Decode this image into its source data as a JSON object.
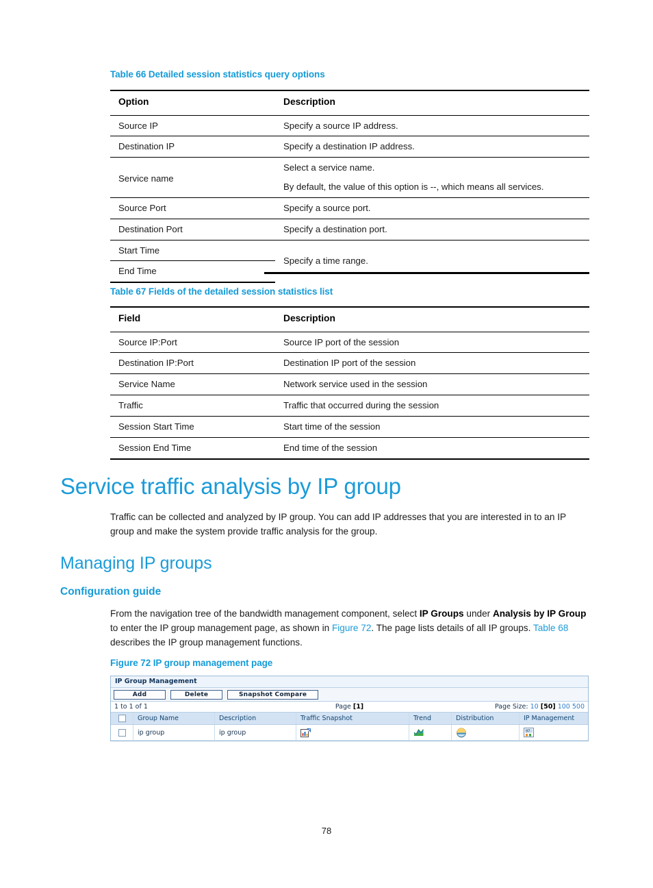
{
  "colors": {
    "heading_blue": "#1b9bd8",
    "caption_blue": "#159bd7",
    "link_blue": "#2b7fd1",
    "ui_header_blue": "#d3e3f4"
  },
  "table66": {
    "caption": "Table 66 Detailed session statistics query options",
    "headers": [
      "Option",
      "Description"
    ],
    "rows": [
      {
        "option": "Source IP",
        "description": [
          "Specify a source IP address."
        ]
      },
      {
        "option": "Destination IP",
        "description": [
          "Specify a destination IP address."
        ]
      },
      {
        "option": "Service name",
        "description": [
          "Select a service name.",
          "By default, the value of this option is --, which means all services."
        ]
      },
      {
        "option": "Source Port",
        "description": [
          "Specify a source port."
        ]
      },
      {
        "option": "Destination Port",
        "description": [
          "Specify a destination port."
        ]
      },
      {
        "option": "Start Time",
        "description": [
          "Specify a time range."
        ]
      },
      {
        "option": "End Time",
        "description": [
          ""
        ]
      }
    ]
  },
  "table67": {
    "caption": "Table 67 Fields of the detailed session statistics list",
    "headers": [
      "Field",
      "Description"
    ],
    "rows": [
      {
        "field": "Source IP:Port",
        "description": "Source IP port of the session"
      },
      {
        "field": "Destination IP:Port",
        "description": "Destination IP port of the session"
      },
      {
        "field": "Service Name",
        "description": "Network service used in the session"
      },
      {
        "field": "Traffic",
        "description": "Traffic that occurred during the session"
      },
      {
        "field": "Session Start Time",
        "description": "Start time of the session"
      },
      {
        "field": "Session End Time",
        "description": "End time of the session"
      }
    ]
  },
  "section": {
    "h1": "Service traffic analysis by IP group",
    "intro": "Traffic can be collected and analyzed by IP group. You can add IP addresses that you are interested in to an IP group and make the system provide traffic analysis for the group.",
    "h2": "Managing IP groups",
    "h3": "Configuration guide",
    "figure_caption": "Figure 72 IP group management page"
  },
  "config_paragraph": {
    "p1": "From the navigation tree of the bandwidth management component, select ",
    "b1": "IP Groups",
    "p2": " under ",
    "b2": "Analysis by IP Group",
    "p3": " to enter the IP group management page, as shown in ",
    "x1": "Figure 72",
    "p4": ". The page lists details of all IP groups. ",
    "x2": "Table 68",
    "p5": " describes the IP group management functions."
  },
  "figure": {
    "window_title": "IP Group Management",
    "buttons": {
      "add": "Add",
      "delete": "Delete",
      "snapshot_compare": "Snapshot Compare"
    },
    "pager": {
      "range": "1 to 1 of 1",
      "page_label": "Page ",
      "page_current": "[1]",
      "page_size_label": "Page Size: ",
      "sizes": [
        "10",
        "[50]",
        "100",
        "500"
      ],
      "selected_size": "[50]"
    },
    "columns": [
      "",
      "Group Name",
      "Description",
      "Traffic Snapshot",
      "Trend",
      "Distribution",
      "IP Management"
    ],
    "rows": [
      {
        "group_name": "ip group",
        "description": "ip group",
        "traffic_snapshot_icon": "bar-chart-arrow-icon",
        "trend_icon": "area-chart-icon",
        "distribution_icon": "pie-sphere-icon",
        "ip_management_icon": "ip-management-icon"
      }
    ]
  },
  "footer": {
    "page_number": "78"
  }
}
